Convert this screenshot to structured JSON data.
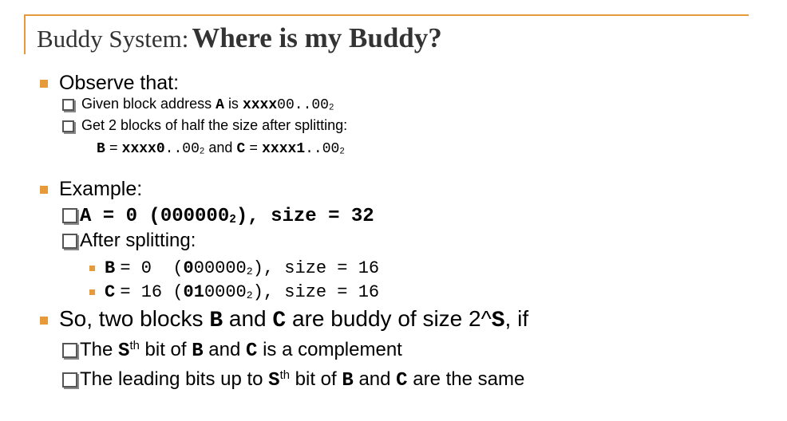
{
  "title": {
    "part1": "Buddy System:",
    "part2": "Where is my Buddy?"
  },
  "observe": {
    "heading": "Observe that:",
    "item1": {
      "prefix": "Given block address",
      "var": "A",
      "is": "is",
      "addr_bold": "xxxx",
      "addr_rest": "00..00",
      "base": "2"
    },
    "item2": {
      "text": "Get 2 blocks of half the size after splitting:"
    },
    "item3": {
      "b": "B",
      "eq": "=",
      "b_bold": "xxxx0",
      "b_rest": "..00",
      "base": "2",
      "and": "and",
      "c": "C",
      "c_bold": "xxxx1",
      "c_rest": "..00"
    }
  },
  "example": {
    "heading": "Example:",
    "item1": {
      "lead": "A = 0 (000000",
      "base": "2",
      "trail": "), size = 32"
    },
    "item2": {
      "text": "After splitting:"
    },
    "b_row": {
      "var": "B",
      "eq": "= 0  (",
      "bits_bold": "0",
      "bits_rest": "00000",
      "base": "2",
      "trail": "), size = 16"
    },
    "c_row": {
      "var": "C",
      "eq": "= 16 (",
      "bits_bold": "01",
      "bits_rest": "0000",
      "base": "2",
      "trail": "), size = 16"
    }
  },
  "so": {
    "prefix": "So, two blocks",
    "b": "B",
    "and": "and",
    "c": "C",
    "suffix": "are buddy of size 2^",
    "s": "S",
    "end": ", if",
    "item1": {
      "the": "The",
      "s": "S",
      "sup": "th",
      "mid": "bit of",
      "b": "B",
      "and": "and",
      "c": "C",
      "end": "is a complement"
    },
    "item2": {
      "lead": "The leading bits up to",
      "s": "S",
      "sup": "th",
      "mid": "bit of",
      "b": "B",
      "and": "and",
      "c": "C",
      "end": "are the same"
    }
  },
  "colors": {
    "accent": "#e69a3a",
    "title": "#333333"
  }
}
